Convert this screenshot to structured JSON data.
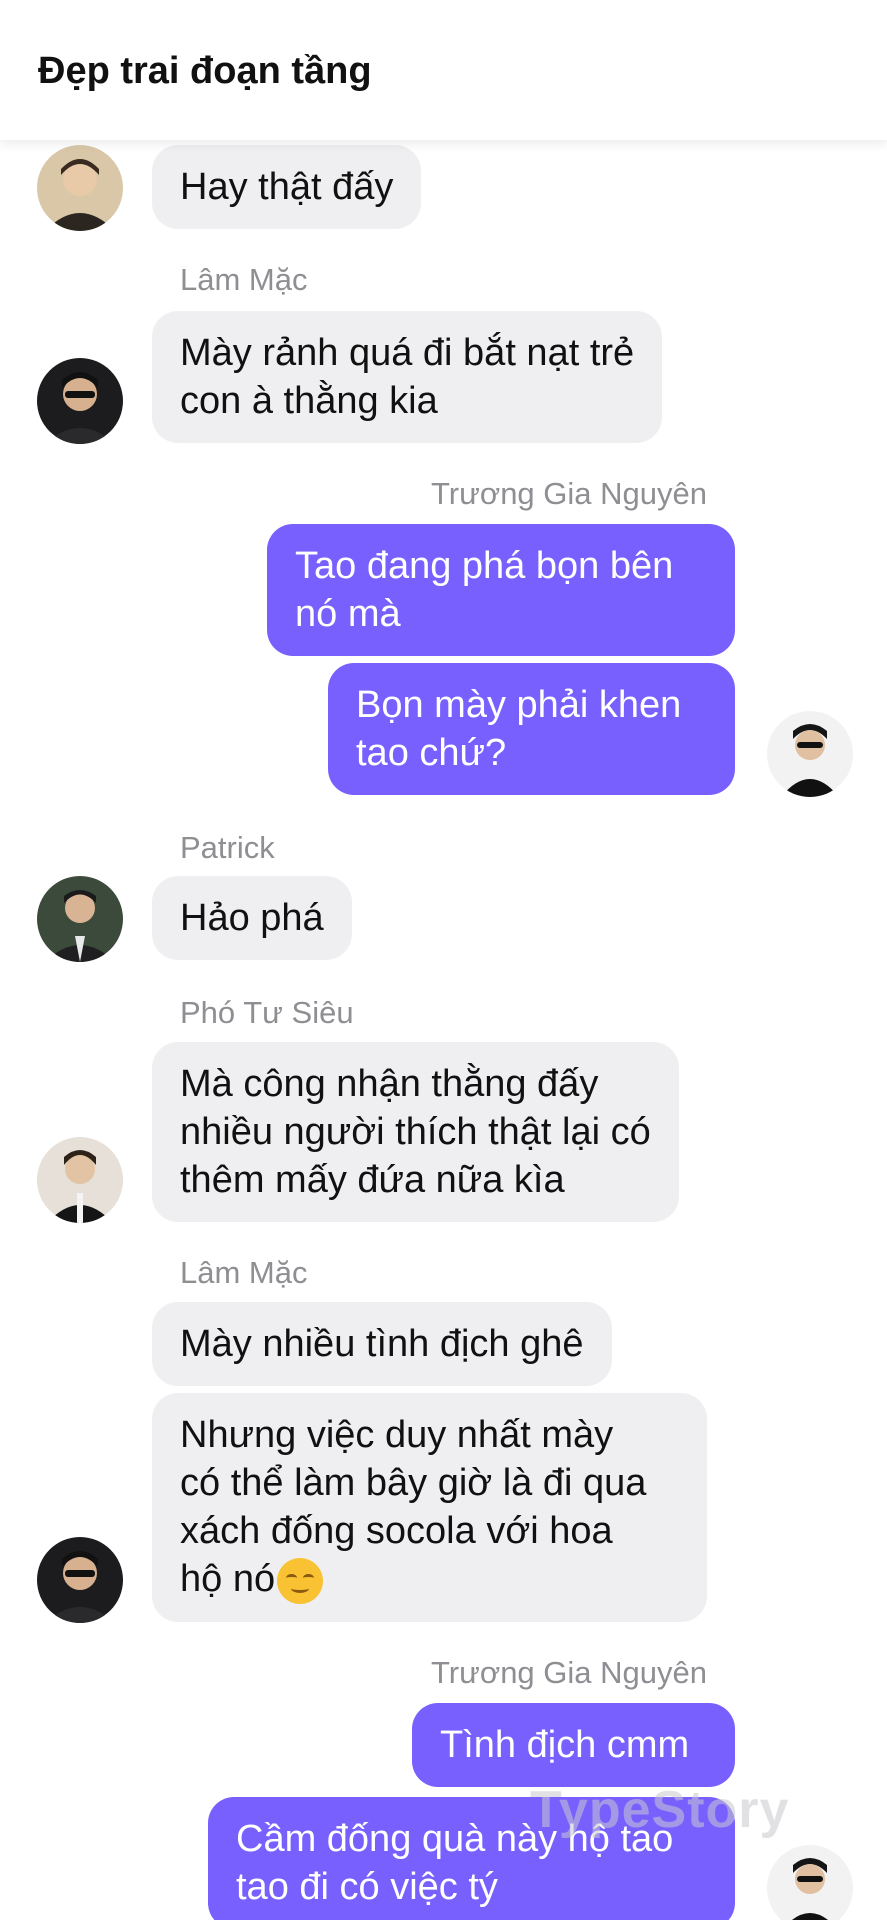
{
  "header": {
    "title": "Đẹp trai đoạn tầng"
  },
  "messages": {
    "m1": "Hay thật đấy",
    "s2": "Lâm Mặc",
    "m2": [
      "Mày rảnh quá đi bắt nạt trẻ",
      "con à thằng kia"
    ],
    "s3": "Trương Gia Nguyên",
    "m3a": [
      "Tao đang phá bọn bên",
      "nó mà"
    ],
    "m3b": [
      "Bọn mày phải khen",
      "tao chứ?"
    ],
    "s4": "Patrick",
    "m4": "Hảo phá",
    "s5": "Phó Tư Siêu",
    "m5": [
      "Mà công nhận thằng đấy",
      "nhiều người thích thật lại có",
      "thêm mấy đứa nữa kìa"
    ],
    "s6": "Lâm Mặc",
    "m6a": "Mày nhiều tình địch ghê",
    "m6b": [
      "Nhưng việc duy nhất mày",
      "có thể làm bây giờ là đi qua",
      "xách đống socola với hoa",
      "hộ nó"
    ],
    "s7": "Trương Gia Nguyên",
    "m7a": "Tình địch cmm",
    "m7b": [
      "Cầm đống quà này hộ tao",
      "tao đi có việc tý"
    ]
  },
  "icons": {
    "emoji": "relieved-face-emoji"
  },
  "watermark": "TypeStory",
  "colors": {
    "outgoing": "#7860ff",
    "incoming": "#efeff1"
  }
}
